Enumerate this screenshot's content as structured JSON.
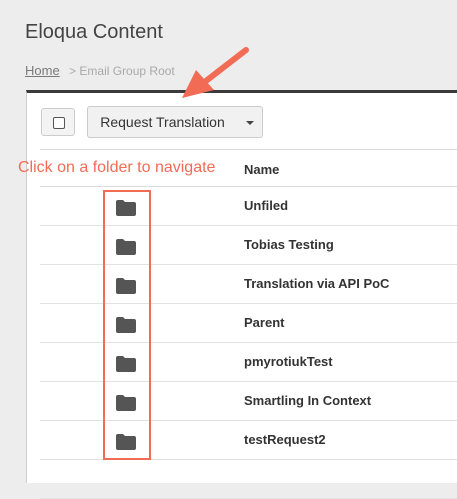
{
  "header": {
    "title": "Eloqua Content"
  },
  "breadcrumb": {
    "home": "Home",
    "separator": ">",
    "current": "Email Group Root"
  },
  "toolbar": {
    "request_label": "Request Translation"
  },
  "table": {
    "column_name": "Name"
  },
  "folders": [
    {
      "name": "Unfiled"
    },
    {
      "name": "Tobias Testing"
    },
    {
      "name": "Translation via API PoC"
    },
    {
      "name": "Parent"
    },
    {
      "name": "pmyrotiukTest"
    },
    {
      "name": "Smartling In Context"
    },
    {
      "name": "testRequest2"
    }
  ],
  "annotation": {
    "text": "Click on a folder to navigate"
  },
  "colors": {
    "annotation": "#f26b55",
    "icon": "#555555"
  }
}
